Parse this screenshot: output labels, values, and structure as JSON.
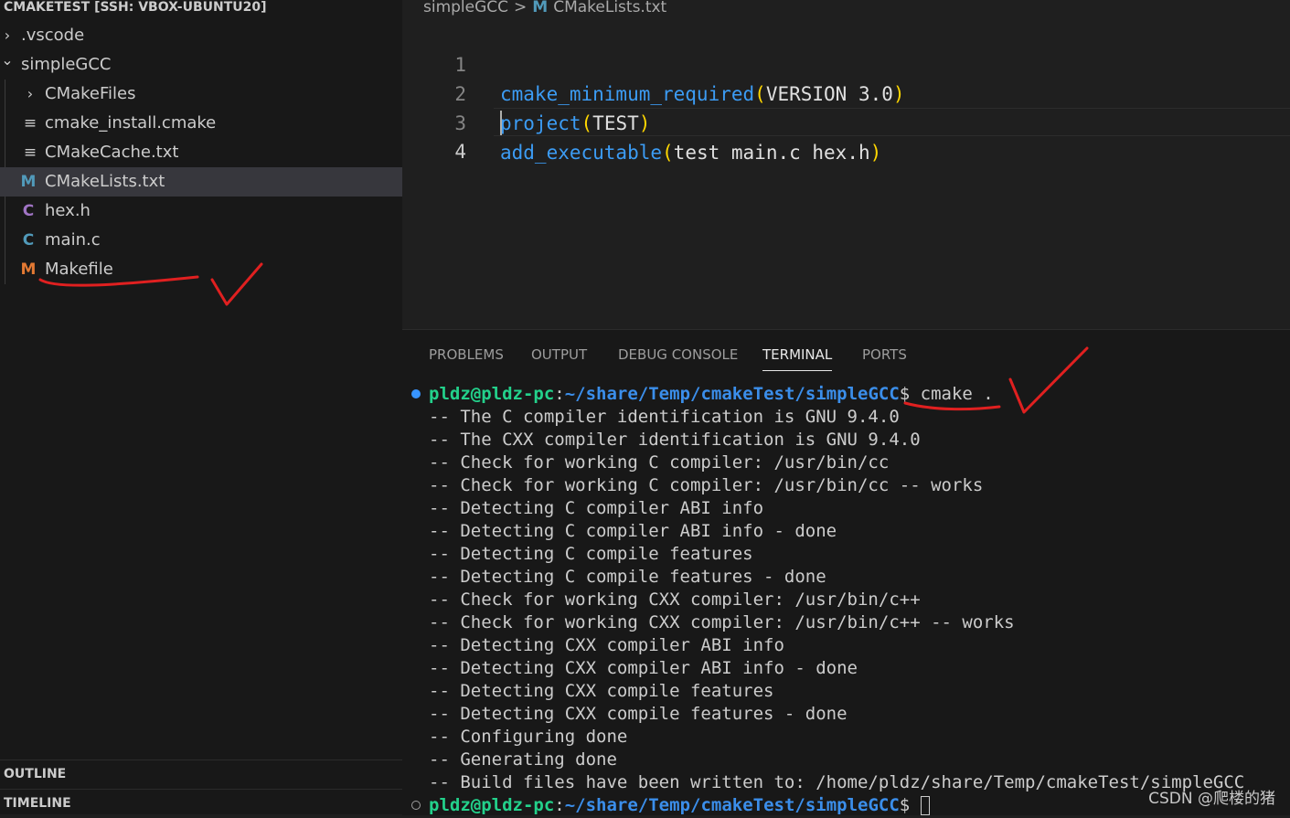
{
  "explorer": {
    "title": "CMAKETEST [SSH: VBOX-UBUNTU20]",
    "items": [
      {
        "label": ".vscode",
        "chevron": "›"
      },
      {
        "label": "simpleGCC",
        "chevron": "⌄"
      },
      {
        "label": "CMakeFiles",
        "chevron": "›"
      },
      {
        "label": "cmake_install.cmake",
        "icon": "≡"
      },
      {
        "label": "CMakeCache.txt",
        "icon": "≡"
      },
      {
        "label": "CMakeLists.txt",
        "icon": "M"
      },
      {
        "label": "hex.h",
        "icon": "C"
      },
      {
        "label": "main.c",
        "icon": "C"
      },
      {
        "label": "Makefile",
        "icon": "M"
      }
    ],
    "outline_label": "OUTLINE",
    "timeline_label": "TIMELINE"
  },
  "breadcrumb": {
    "folder": "simpleGCC",
    "separator": ">",
    "file_icon": "M",
    "file": "CMakeLists.txt"
  },
  "editor": {
    "lines": [
      {
        "number": "1",
        "fn": "cmake_minimum_required",
        "open": "(",
        "args": "VERSION 3.0",
        "close": ")"
      },
      {
        "number": "2",
        "fn": "project",
        "open": "(",
        "args": "TEST",
        "close": ")"
      },
      {
        "number": "3",
        "fn": "add_executable",
        "open": "(",
        "args": "test main.c hex.h",
        "close": ")"
      },
      {
        "number": "4",
        "fn": "",
        "open": "",
        "args": "",
        "close": ""
      }
    ]
  },
  "panel": {
    "tabs": [
      "PROBLEMS",
      "OUTPUT",
      "DEBUG CONSOLE",
      "TERMINAL",
      "PORTS"
    ],
    "active_tab": "TERMINAL"
  },
  "terminal": {
    "user": "pldz@pldz-pc",
    "colon": ":",
    "path": "~/share/Temp/cmakeTest/simpleGCC",
    "prompt_symbol": "$ ",
    "command": "cmake .",
    "output": [
      "-- The C compiler identification is GNU 9.4.0",
      "-- The CXX compiler identification is GNU 9.4.0",
      "-- Check for working C compiler: /usr/bin/cc",
      "-- Check for working C compiler: /usr/bin/cc -- works",
      "-- Detecting C compiler ABI info",
      "-- Detecting C compiler ABI info - done",
      "-- Detecting C compile features",
      "-- Detecting C compile features - done",
      "-- Check for working CXX compiler: /usr/bin/c++",
      "-- Check for working CXX compiler: /usr/bin/c++ -- works",
      "-- Detecting CXX compiler ABI info",
      "-- Detecting CXX compiler ABI info - done",
      "-- Detecting CXX compile features",
      "-- Detecting CXX compile features - done",
      "-- Configuring done",
      "-- Generating done",
      "-- Build files have been written to: /home/pldz/share/Temp/cmakeTest/simpleGCC"
    ]
  },
  "watermark": "CSDN @爬楼的猪",
  "colors": {
    "annotation": "#e02020",
    "makefile_icon": "#e37933",
    "c_icon_header": "#a074c4",
    "c_icon_source": "#519aba",
    "cmake_icon": "#519aba"
  }
}
